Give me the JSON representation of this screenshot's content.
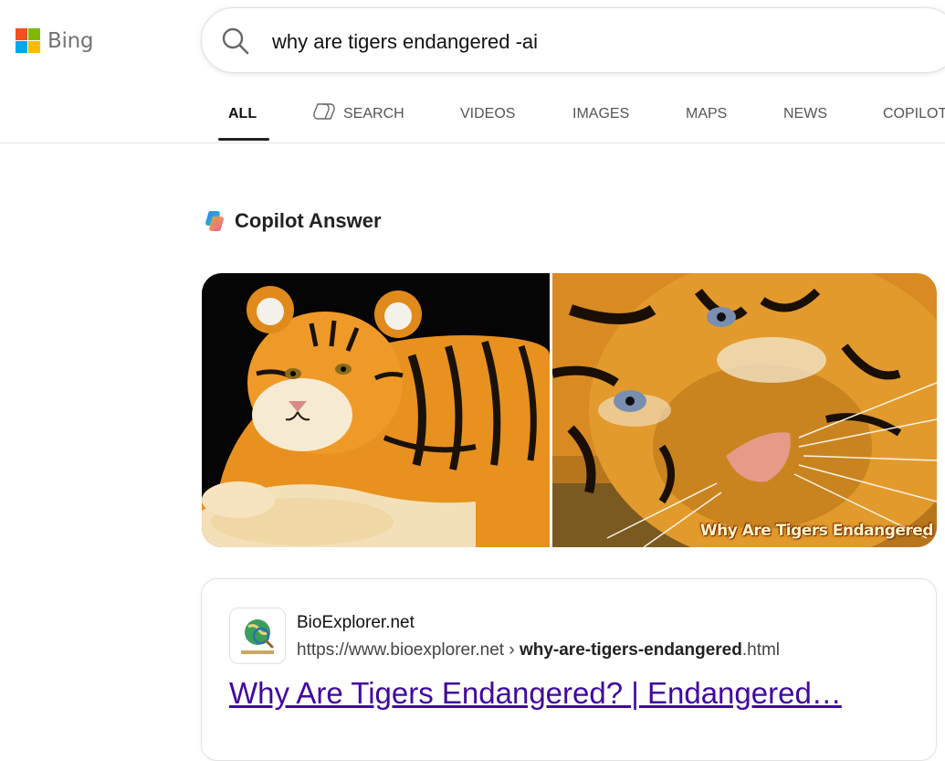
{
  "brand": {
    "name": "Bing",
    "colors": {
      "red": "#f25022",
      "green": "#7fba00",
      "blue": "#00a4ef",
      "yellow": "#ffb900"
    }
  },
  "search": {
    "query": "why are tigers endangered -ai",
    "icon": "search-icon"
  },
  "tabs": [
    {
      "label": "ALL",
      "active": true
    },
    {
      "label": "SEARCH",
      "icon": "copilot-search-icon"
    },
    {
      "label": "VIDEOS"
    },
    {
      "label": "IMAGES"
    },
    {
      "label": "MAPS"
    },
    {
      "label": "NEWS"
    },
    {
      "label": "COPILOT"
    }
  ],
  "copilot_answer": {
    "title": "Copilot Answer",
    "images": [
      {
        "alt": "tiger cub lying down"
      },
      {
        "alt": "tiger face close-up",
        "caption": "Why Are Tigers Endangered"
      }
    ]
  },
  "result": {
    "site_name": "BioExplorer.net",
    "url_prefix": "https://www.bioexplorer.net › ",
    "url_bold": "why-are-tigers-endangered",
    "url_suffix": ".html",
    "title": "Why Are Tigers Endangered? | Endangered…",
    "title_color": "#4007a2"
  }
}
